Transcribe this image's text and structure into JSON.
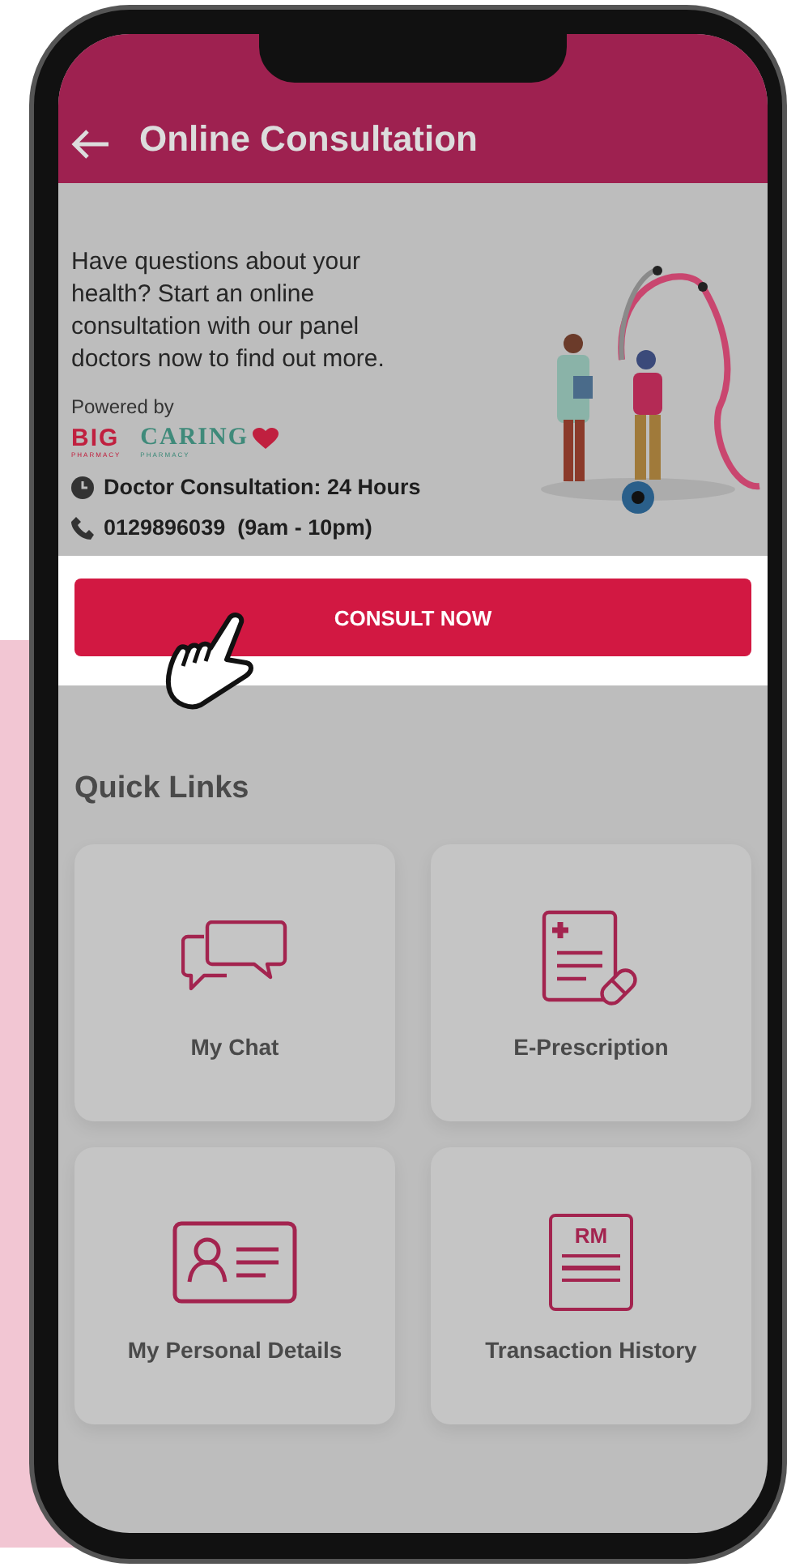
{
  "header": {
    "title": "Online Consultation"
  },
  "intro": {
    "description": "Have questions about your health? Start an online consultation with our panel doctors now to find out more.",
    "powered_by": "Powered by",
    "partners": [
      {
        "kind": "big",
        "name": "BIG",
        "subtitle": "PHARMACY"
      },
      {
        "kind": "caring",
        "name": "CARING",
        "subtitle": "PHARMACY"
      }
    ]
  },
  "contact": [
    {
      "kind": "clock",
      "text": "Doctor Consultation: 24 Hours"
    },
    {
      "kind": "phone",
      "text": "0129896039  (9am - 10pm)"
    }
  ],
  "consult_button": {
    "label": "CONSULT NOW"
  },
  "quick_links": {
    "title": "Quick Links",
    "items": [
      {
        "kind": "chat",
        "label": "My Chat"
      },
      {
        "kind": "prescription",
        "label": "E-Prescription"
      },
      {
        "kind": "id_card",
        "label": "My Personal Details"
      },
      {
        "kind": "receipt",
        "label": "Transaction History"
      }
    ],
    "receipt_icon_text": "RM"
  }
}
